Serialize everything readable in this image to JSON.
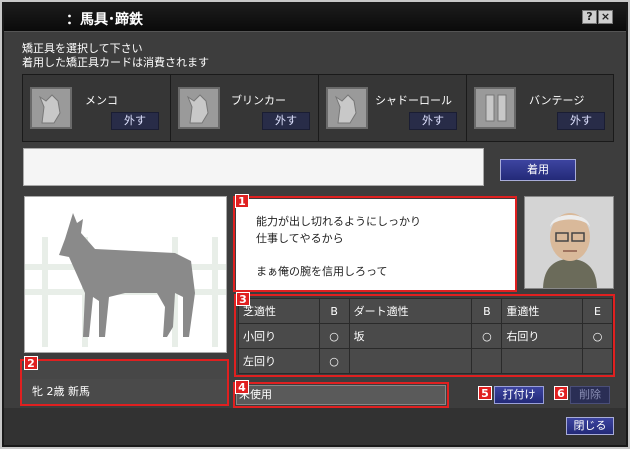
{
  "window": {
    "title": "：馬具･蹄鉄",
    "help_label": "?",
    "close_label": "×"
  },
  "instructions": {
    "line1": "矯正具を選択して下さい",
    "line2": "着用した矯正具カードは消費されます"
  },
  "equipment_slots": [
    {
      "label": "メンコ",
      "remove_label": "外す",
      "icon": "horse-hood-icon"
    },
    {
      "label": "ブリンカー",
      "remove_label": "外す",
      "icon": "blinker-icon"
    },
    {
      "label": "シャドーロール",
      "remove_label": "外す",
      "icon": "shadow-roll-icon"
    },
    {
      "label": "バンテージ",
      "remove_label": "外す",
      "icon": "bandage-icon"
    }
  ],
  "wear_button": "着用",
  "markers": {
    "m1": "1",
    "m2": "2",
    "m3": "3",
    "m4": "4",
    "m5": "5",
    "m6": "6"
  },
  "message": {
    "line1": "能力が出し切れるようにしっかり",
    "line2": "仕事してやるから",
    "line3": "まぁ俺の腕を信用しろって"
  },
  "aptitude": {
    "row1": [
      "芝適性",
      "B",
      "ダート適性",
      "B",
      "重適性",
      "E"
    ],
    "row2": [
      "小回り",
      "○",
      "坂",
      "○",
      "右回り",
      "○"
    ],
    "row3": [
      "左回り",
      "○",
      "",
      "",
      "",
      ""
    ]
  },
  "horse": {
    "name_info": "牝 2歳 新馬"
  },
  "unused_label": "未使用",
  "attach_button": "打付け",
  "delete_button": "削除",
  "close_button": "閉じる",
  "colors": {
    "marker": "#e02020",
    "button": "#2a3288"
  }
}
